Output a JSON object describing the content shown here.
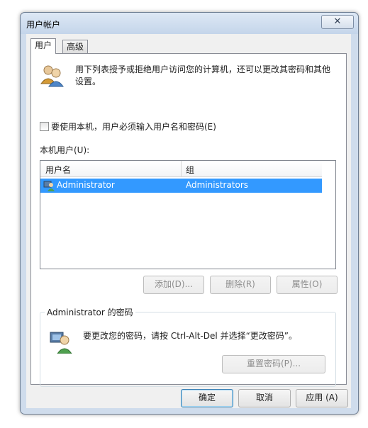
{
  "window": {
    "title": "用户帐户",
    "close_symbol": "✕"
  },
  "tabs": [
    {
      "label": "用户"
    },
    {
      "label": "高级"
    }
  ],
  "main": {
    "description": "用下列表授予或拒绝用户访问您的计算机，还可以更改其密码和其他设置。",
    "checkbox_label": "要使用本机，用户必须输入用户名和密码(E)",
    "checkbox_checked": false,
    "list_label": "本机用户(U):",
    "columns": [
      "用户名",
      "组"
    ],
    "rows": [
      {
        "name": "Administrator",
        "group": "Administrators",
        "selected": true
      }
    ],
    "buttons": {
      "add": "添加(D)...",
      "remove": "删除(R)",
      "properties": "属性(O)"
    }
  },
  "password_group": {
    "title": "Administrator 的密码",
    "message": "要更改您的密码，请按 Ctrl-Alt-Del 并选择“更改密码”。",
    "reset_button": "重置密码(P)..."
  },
  "footer": {
    "ok": "确定",
    "cancel": "取消",
    "apply": "应用 (A)"
  },
  "colors": {
    "selection": "#3399ff",
    "window_frame": "#cfdcec"
  },
  "icons": {
    "users": "users-icon",
    "password": "user-key-icon",
    "row": "user-icon"
  }
}
